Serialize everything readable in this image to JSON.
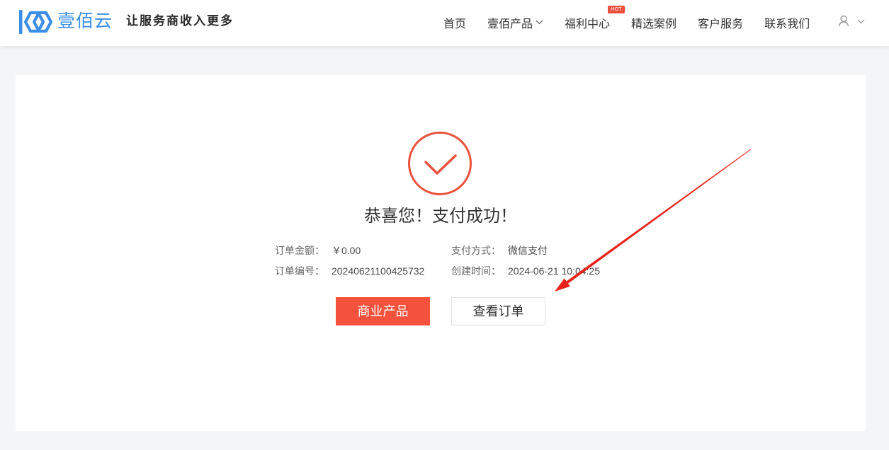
{
  "header": {
    "logo_icon": "brand-logo-icon",
    "brand_name": "壹佰云",
    "slogan": "让服务商收入更多",
    "nav": [
      {
        "label": "首页"
      },
      {
        "label": "壹佰产品",
        "dropdown_icon": "chevron-down-icon"
      },
      {
        "label": "福利中心",
        "badge": "HOT"
      },
      {
        "label": "精选案例"
      },
      {
        "label": "客户服务"
      },
      {
        "label": "联系我们"
      }
    ],
    "user_menu": {
      "icon": "user-icon",
      "dropdown_icon": "chevron-down-icon"
    }
  },
  "result": {
    "status_icon": "check-circle-icon",
    "title": "恭喜您！支付成功！",
    "details": [
      [
        {
          "label": "订单金额：",
          "value": "￥0.00"
        },
        {
          "label": "支付方式：",
          "value": "微信支付"
        }
      ],
      [
        {
          "label": "订单编号：",
          "value": "20240621100425732"
        },
        {
          "label": "创建时间：",
          "value": "2024-06-21 10:04:25"
        }
      ]
    ],
    "actions": {
      "primary_label": "商业产品",
      "secondary_label": "查看订单"
    }
  },
  "colors": {
    "brand": "#3a8ee6",
    "accent": "#f4523d",
    "success_ring": "#e9533f",
    "hot_badge": "#e94f3c",
    "annotation_arrow": "#e8231c",
    "page_background": "#f4f5f7"
  }
}
